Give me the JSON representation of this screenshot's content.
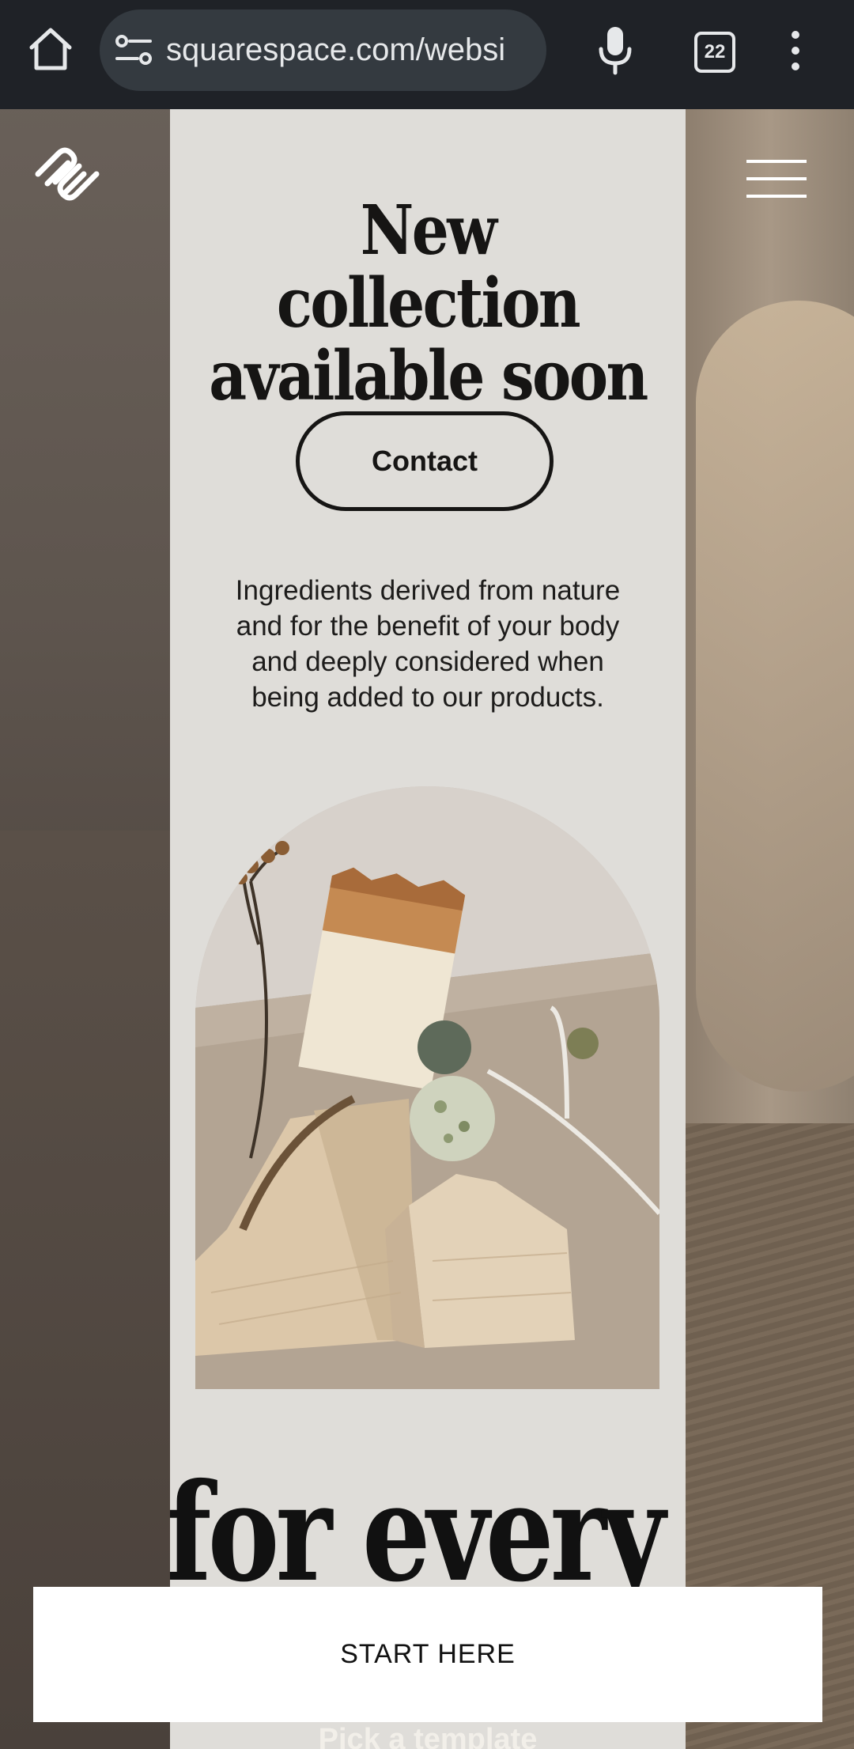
{
  "browser": {
    "url": "squarespace.com/websi",
    "tab_count": "22",
    "icons": [
      "home-icon",
      "site-info-icon",
      "microphone-icon",
      "tabs-icon",
      "more-vertical-icon"
    ]
  },
  "site": {
    "logo": "squarespace-logo",
    "menu_icon": "hamburger-menu-icon"
  },
  "preview": {
    "headline_line1": "New collection",
    "headline_line2": "available soon",
    "contact_label": "Contact",
    "body_line1": "Ingredients derived from nature",
    "body_line2": "and for the benefit of your body",
    "body_line3": "and deeply considered when",
    "body_line4": "being added to our products.",
    "big_text": "for every"
  },
  "cta": {
    "start_label": "START HERE",
    "pick_label": "Pick a template"
  },
  "colors": {
    "chrome_bg": "#1f2227",
    "panel_bg": "#dfddd9",
    "text_dark": "#161514"
  }
}
